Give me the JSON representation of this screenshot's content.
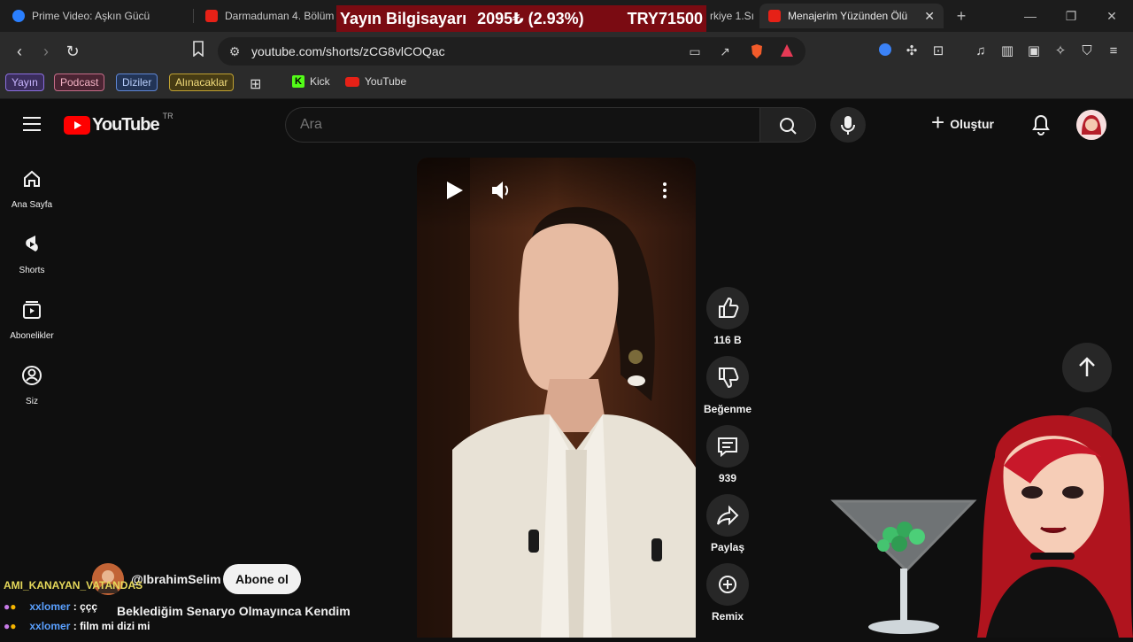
{
  "browser": {
    "tabs": [
      {
        "title": "Prime Video: Aşkın Gücü",
        "favicon_color": "#2a7fff"
      },
      {
        "title": "Darmaduman 4. Bölüm",
        "favicon_color": "#e62117"
      },
      {
        "title": "rkiye 1.Sı",
        "favicon_color": "#e62117"
      },
      {
        "title": "Menajerim Yüzünden Ölü",
        "favicon_color": "#e62117"
      }
    ],
    "new_tab_symbol": "+",
    "url": "youtube.com/shorts/zCG8vlCOQac",
    "bookmarks": {
      "chips": [
        {
          "label": "Yayın",
          "color": "#a98ef0"
        },
        {
          "label": "Podcast",
          "color": "#e48aa4"
        },
        {
          "label": "Diziler",
          "color": "#7ea7f0"
        },
        {
          "label": "Alınacaklar",
          "color": "#e5c64a"
        }
      ],
      "links": [
        {
          "label": "Kick",
          "color": "#53fc18"
        },
        {
          "label": "YouTube",
          "color": "#e62117"
        }
      ]
    }
  },
  "overlay_banner": {
    "name": "Yayın Bilgisayarı",
    "value": "2095₺ (2.93%)",
    "currency": "TRY71500"
  },
  "youtube": {
    "logo_text": "YouTube",
    "region": "TR",
    "search_placeholder": "Ara",
    "create_label": "Oluştur",
    "sidebar": [
      {
        "label": "Ana Sayfa",
        "icon": "home-icon"
      },
      {
        "label": "Shorts",
        "icon": "shorts-icon"
      },
      {
        "label": "Abonelikler",
        "icon": "subscriptions-icon"
      },
      {
        "label": "Siz",
        "icon": "you-icon"
      }
    ],
    "actions": {
      "likes": "116 B",
      "dislike": "Beğenme",
      "comments": "939",
      "share": "Paylaş",
      "remix": "Remix"
    },
    "channel": "@IbrahimSelim",
    "subscribe_label": "Abone ol",
    "short_title": "Beklediğim Senaryo Olmayınca Kendim"
  },
  "chat": [
    {
      "user": "AMI_KANAYAN_VATANDAS",
      "message": "",
      "user_color": "#e5d85a"
    },
    {
      "user": "xxlomer",
      "message": "ççç",
      "user_color": "#5aa0ff"
    },
    {
      "user": "xxlomer",
      "message": "film mi dizi mi",
      "user_color": "#5aa0ff"
    }
  ],
  "colors": {
    "yt_red": "#ff0000",
    "banner_bg": "#7a0b12"
  }
}
